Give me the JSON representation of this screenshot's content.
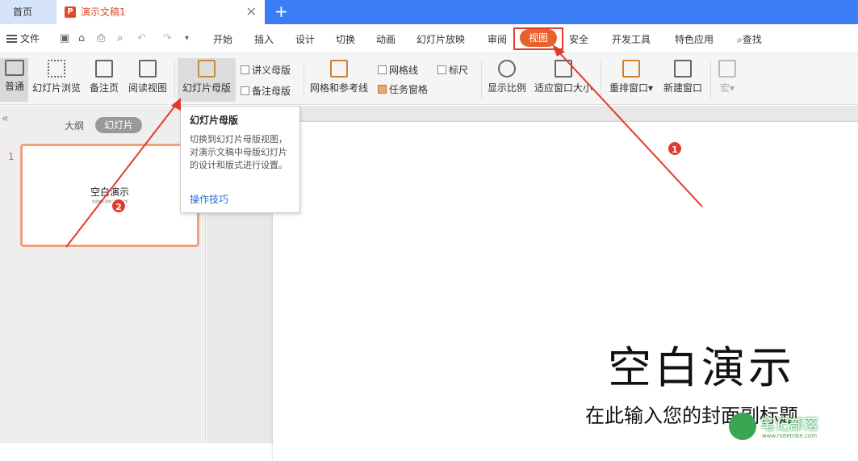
{
  "tabs": {
    "home": "首页",
    "doc": "演示文稿1",
    "close": "✕",
    "add": "+"
  },
  "menubar": {
    "file": "文件",
    "items": [
      "开始",
      "插入",
      "设计",
      "切换",
      "动画",
      "幻灯片放映",
      "审阅",
      "视图",
      "安全",
      "开发工具",
      "特色应用"
    ],
    "search": "查找"
  },
  "ribbon": {
    "normal": "普通",
    "slide_browse": "幻灯片浏览",
    "notes_page": "备注页",
    "reading_view": "阅读视图",
    "slide_master": "幻灯片母版",
    "handout_master": "讲义母版",
    "notes_master": "备注母版",
    "grid_guides": "网格和参考线",
    "gridlines": "网格线",
    "ruler": "标尺",
    "task_pane": "任务窗格",
    "zoom": "显示比例",
    "fit_window": "适应窗口大小",
    "arrange": "重排窗口",
    "new_window": "新建窗口",
    "macro": "宏"
  },
  "leftpane": {
    "outline_tab": "大纲",
    "slides_tab": "幻灯片",
    "thumb_number": "1",
    "thumb_title": "空白演示",
    "thumb_subtitle": "在此输入您的封面副标题"
  },
  "tooltip": {
    "title": "幻灯片母版",
    "desc": "切换到幻灯片母版视图，对演示文稿中母版幻灯片的设计和版式进行设置。",
    "link": "操作技巧"
  },
  "slide": {
    "title": "空白演示",
    "subtitle": "在此输入您的封面副标题"
  },
  "annotations": {
    "badge1": "1",
    "badge2": "2",
    "color": "#e23b2e"
  },
  "watermark": {
    "text": "笔记部落",
    "url": "www.notetribe.com"
  }
}
